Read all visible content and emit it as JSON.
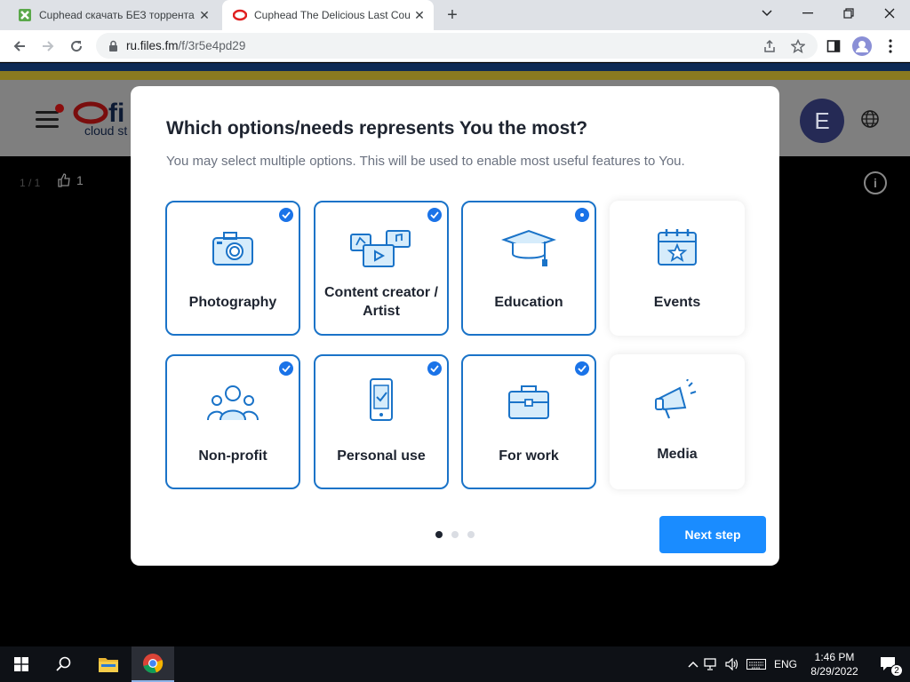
{
  "browser": {
    "tabs": [
      {
        "title": "Cuphead скачать БЕЗ торрента",
        "active": false
      },
      {
        "title": "Cuphead The Delicious Last Cour",
        "active": true
      }
    ],
    "url_host": "ru.files.fm",
    "url_path": "/f/3r5e4pd29"
  },
  "site": {
    "logo_text": "fi",
    "logo_sub": "cloud st",
    "avatar_letter": "E",
    "counter": "1 / 1",
    "likes": "1"
  },
  "modal": {
    "title": "Which options/needs represents You the most?",
    "subtitle": "You may select multiple options. This will be used to enable most useful features to You.",
    "options": [
      {
        "label": "Photography",
        "selected": true,
        "icon": "camera-icon"
      },
      {
        "label": "Content creator / Artist",
        "selected": true,
        "icon": "media-files-icon"
      },
      {
        "label": "Education",
        "selected": true,
        "icon": "graduation-cap-icon"
      },
      {
        "label": "Events",
        "selected": false,
        "icon": "calendar-star-icon"
      },
      {
        "label": "Non-profit",
        "selected": true,
        "icon": "people-group-icon"
      },
      {
        "label": "Personal use",
        "selected": true,
        "icon": "smartphone-check-icon"
      },
      {
        "label": "For work",
        "selected": true,
        "icon": "briefcase-icon"
      },
      {
        "label": "Media",
        "selected": false,
        "icon": "megaphone-icon"
      }
    ],
    "next_label": "Next step",
    "step_dots": 3,
    "current_step": 1
  },
  "taskbar": {
    "language": "ENG",
    "time": "1:46 PM",
    "date": "8/29/2022",
    "notifications": "2"
  },
  "colors": {
    "accent": "#1a8cff",
    "selected_border": "#1a73c8",
    "icon_blue": "#1a73c8"
  }
}
